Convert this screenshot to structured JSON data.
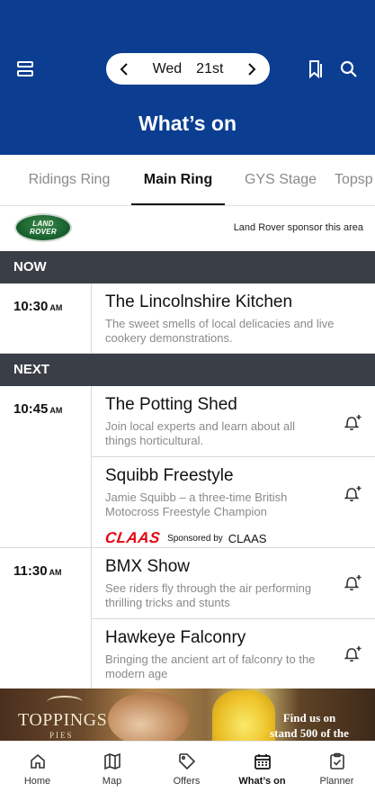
{
  "header": {
    "date": {
      "day": "Wed",
      "date": "21st"
    },
    "title": "What’s on"
  },
  "tabs": [
    {
      "label": "Ridings Ring",
      "active": false
    },
    {
      "label": "Main Ring",
      "active": true
    },
    {
      "label": "GYS Stage",
      "active": false
    },
    {
      "label": "Topsp",
      "active": false
    }
  ],
  "sponsor": {
    "logo_line1": "LAND",
    "logo_line2": "ROVER",
    "text": "Land Rover sponsor this area"
  },
  "sections": {
    "now": "NOW",
    "next": "NEXT"
  },
  "schedule": {
    "now_slot": {
      "time": "10:30",
      "ampm": "AM",
      "events": [
        {
          "title": "The Lincolnshire Kitchen",
          "desc": "The sweet smells of local delicacies and live cookery demonstrations."
        }
      ]
    },
    "next_slots": [
      {
        "time": "10:45",
        "ampm": "AM",
        "events": [
          {
            "title": "The Potting Shed",
            "desc": "Join local experts and learn about all things horticultural."
          },
          {
            "title": "Squibb Freestyle",
            "desc": "Jamie Squibb – a three-time British Motocross Freestyle Champion",
            "sponsor_logo": "CLAAS",
            "sponsored_by": "Sponsored by",
            "sponsor_name": "CLAAS"
          }
        ]
      },
      {
        "time": "11:30",
        "ampm": "AM",
        "events": [
          {
            "title": "BMX Show",
            "desc": "See riders fly through the air performing thrilling tricks and stunts"
          },
          {
            "title": "Hawkeye Falconry",
            "desc": "Bringing the ancient art of falconry to the modern age"
          }
        ]
      }
    ]
  },
  "banner": {
    "brand": "TOPPINGS",
    "brand_sub": "PIES",
    "promo": "Find us on stand 500 of the"
  },
  "bottom_nav": [
    {
      "label": "Home",
      "icon": "home-icon",
      "active": false
    },
    {
      "label": "Map",
      "icon": "map-icon",
      "active": false
    },
    {
      "label": "Offers",
      "icon": "tag-icon",
      "active": false
    },
    {
      "label": "What’s on",
      "icon": "calendar-icon",
      "active": true
    },
    {
      "label": "Planner",
      "icon": "clipboard-check-icon",
      "active": false
    }
  ],
  "colors": {
    "brand_blue": "#0b3d91",
    "section_bar": "#3a3f47",
    "claas_red": "#e30613"
  }
}
